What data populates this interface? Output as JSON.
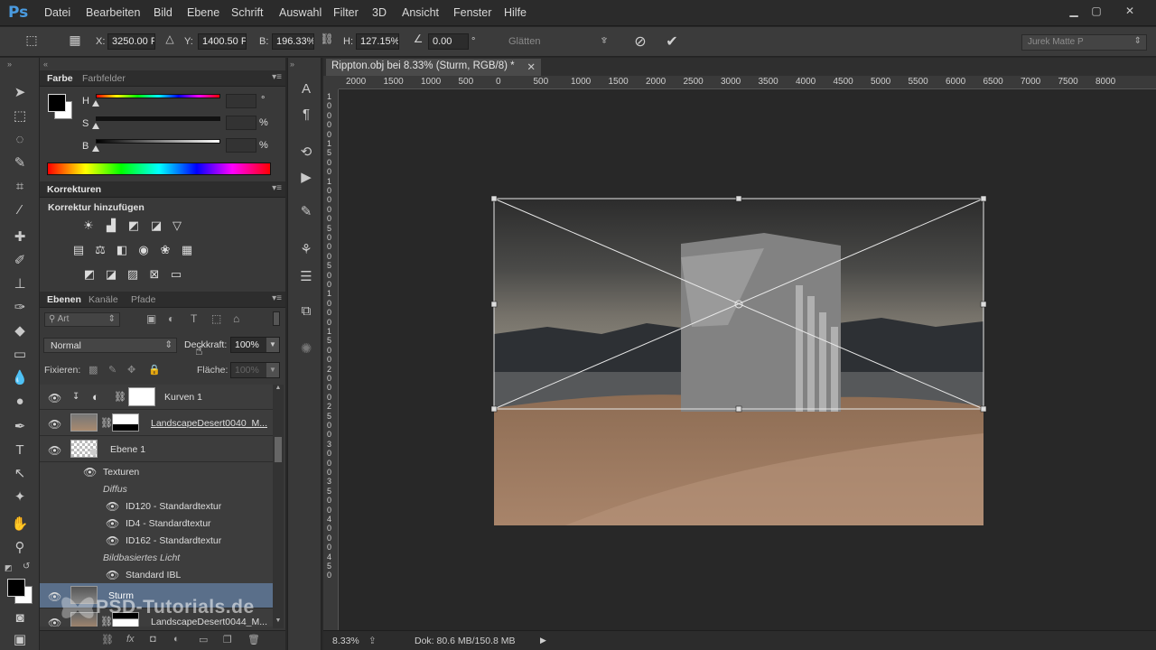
{
  "menubar": {
    "logo": "Ps",
    "items": [
      "Datei",
      "Bearbeiten",
      "Bild",
      "Ebene",
      "Schrift",
      "Auswahl",
      "Filter",
      "3D",
      "Ansicht",
      "Fenster",
      "Hilfe"
    ]
  },
  "options": {
    "x_label": "X:",
    "x_value": "3250.00 Px",
    "y_label": "Y:",
    "y_value": "1400.50 Px",
    "w_label": "B:",
    "w_value": "196.33%",
    "h_label": "H:",
    "h_value": "127.15%",
    "angle_value": "0.00",
    "degree": "°",
    "smooth_label": "Glätten",
    "workspace": "Jurek Matte P"
  },
  "color_panel": {
    "tabs": [
      "Farbe",
      "Farbfelder"
    ],
    "h_label": "H",
    "h_unit": "°",
    "s_label": "S",
    "s_unit": "%",
    "b_label": "B",
    "b_unit": "%"
  },
  "adjustments_panel": {
    "tab": "Korrekturen",
    "heading": "Korrektur hinzufügen"
  },
  "layers_panel": {
    "tabs": [
      "Ebenen",
      "Kanäle",
      "Pfade"
    ],
    "filter_kind": "Art",
    "blend_mode": "Normal",
    "opacity_label": "Deckkraft:",
    "opacity_value": "100%",
    "lock_label": "Fixieren:",
    "fill_label": "Fläche:",
    "fill_value": "100%",
    "layers": [
      {
        "name": "Kurven 1"
      },
      {
        "name": "LandscapeDesert0040_M..."
      },
      {
        "name": "Ebene 1"
      },
      {
        "name": "Texturen"
      },
      {
        "name": "Diffus"
      },
      {
        "name": "ID120 - Standardtextur"
      },
      {
        "name": "ID4 - Standardtextur"
      },
      {
        "name": "ID162 - Standardtextur"
      },
      {
        "name": "Bildbasiertes Licht"
      },
      {
        "name": "Standard IBL"
      },
      {
        "name": "Sturm"
      },
      {
        "name": "LandscapeDesert0044_M..."
      }
    ]
  },
  "document": {
    "tab_title": "Rippton.obj bei 8.33% (Sturm, RGB/8) *",
    "ruler_top": [
      "2000",
      "1500",
      "1000",
      "500",
      "0",
      "500",
      "1000",
      "1500",
      "2000",
      "2500",
      "3000",
      "3500",
      "4000",
      "4500",
      "5000",
      "5500",
      "6000",
      "6500",
      "7000",
      "7500",
      "8000"
    ],
    "ruler_left": [
      "1",
      "0",
      "0",
      "0",
      "0",
      "1",
      "5",
      "0",
      "0",
      "1",
      "0",
      "0",
      "0",
      "0",
      "5",
      "0",
      "0",
      "0",
      "5",
      "0",
      "0",
      "1",
      "0",
      "0",
      "0",
      "1",
      "5",
      "0",
      "0",
      "2",
      "0",
      "0",
      "0",
      "2",
      "5",
      "0",
      "0",
      "3",
      "0",
      "0",
      "0",
      "3",
      "5",
      "0",
      "0",
      "4",
      "0",
      "0",
      "0",
      "4",
      "5",
      "0"
    ]
  },
  "status": {
    "zoom": "8.33%",
    "doc_info": "Dok: 80.6 MB/150.8 MB"
  },
  "watermark": "PSD-Tutorials.de",
  "colors": {
    "accent": "#4a9be0",
    "selected_layer": "#5a6f8a"
  }
}
